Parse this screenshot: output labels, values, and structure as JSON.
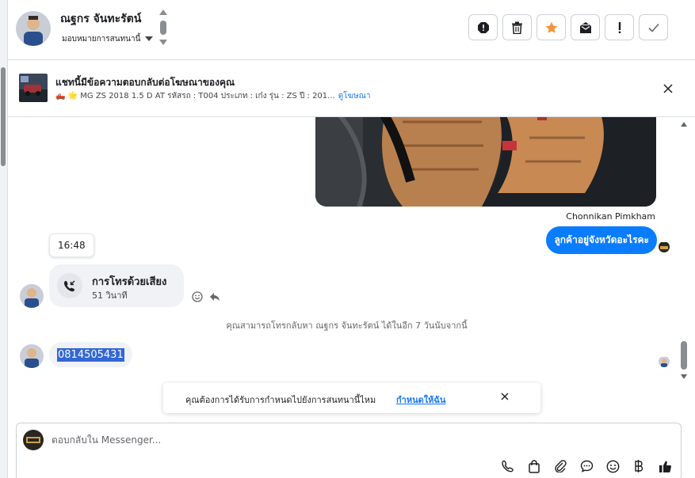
{
  "header": {
    "contact_name": "ณฐกร จันทะรัตน์",
    "assign_label": "มอบหมายการสนทนานี้",
    "tools": [
      {
        "name": "report-spam-icon"
      },
      {
        "name": "trash-icon"
      },
      {
        "name": "star-icon"
      },
      {
        "name": "mark-unread-icon"
      },
      {
        "name": "exclamation-icon"
      },
      {
        "name": "check-icon"
      }
    ]
  },
  "ad_banner": {
    "title": "แชทนี้มีข้อความตอบกลับต่อโฆษณาของคุณ",
    "meta": "🛻 🌟 MG ZS 2018 1.5 D AT รหัสรถ : T004 ประเภท : เก๋ง รุ่น : ZS ปี : 201...",
    "view_ad_link": "ดูโฆษณา"
  },
  "conversation": {
    "sender_name": "Chonnikan Pimkham",
    "outgoing_message": "ลูกค้าอยู่จังหวัดอะไรคะ",
    "timestamp": "16:48",
    "call": {
      "title": "การโทรด้วยเสียง",
      "duration": "51 วินาที"
    },
    "system_note": "คุณสามารถโทรกลับหา ณฐกร จันทะรัตน์ ได้ในอีก 7 วันนับจากนี้",
    "incoming_number": "0814505431"
  },
  "reminder": {
    "text": "คุณต้องการได้รับการกำหนดไปยังการสนทนานี้ไหม",
    "link": "กำหนดให้ฉัน"
  },
  "composer": {
    "placeholder": "ตอบกลับใน Messenger...",
    "value": ""
  },
  "colors": {
    "accent": "#0a7cff",
    "star": "#f7923b",
    "link": "#1877f2"
  }
}
